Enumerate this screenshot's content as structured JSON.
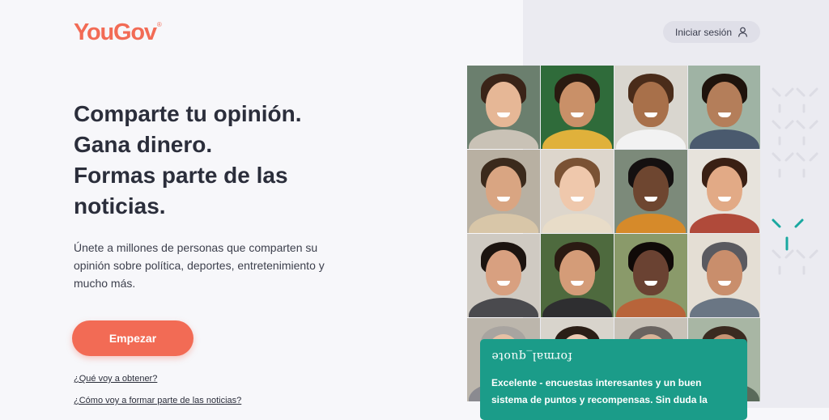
{
  "header": {
    "logo_text": "YouGov",
    "logo_mark": "®",
    "login_label": "Iniciar sesión",
    "login_icon": "user-icon"
  },
  "hero": {
    "headline_lines": [
      "Comparte tu opinión.",
      "Gana dinero.",
      "Formas parte de las",
      "noticias."
    ],
    "subtitle": "Únete a millones de personas que comparten su opinión sobre política, deportes, entretenimiento y mucho más.",
    "cta_label": "Empezar"
  },
  "links": {
    "what_get": "¿Qué voy a obtener?",
    "how_news": "¿Cómo voy a formar parte de las noticias?"
  },
  "review": {
    "rating_text": "formal_quote",
    "text": "Excelente - encuestas interesantes y un buen sistema de puntos y recompensas. Sin duda la"
  },
  "colors": {
    "brand": "#f26b55",
    "review_bg": "#1b9c89",
    "page_bg": "#f7f7fa",
    "panel_bg": "#ebebf1",
    "deco": "#19a8a0"
  }
}
